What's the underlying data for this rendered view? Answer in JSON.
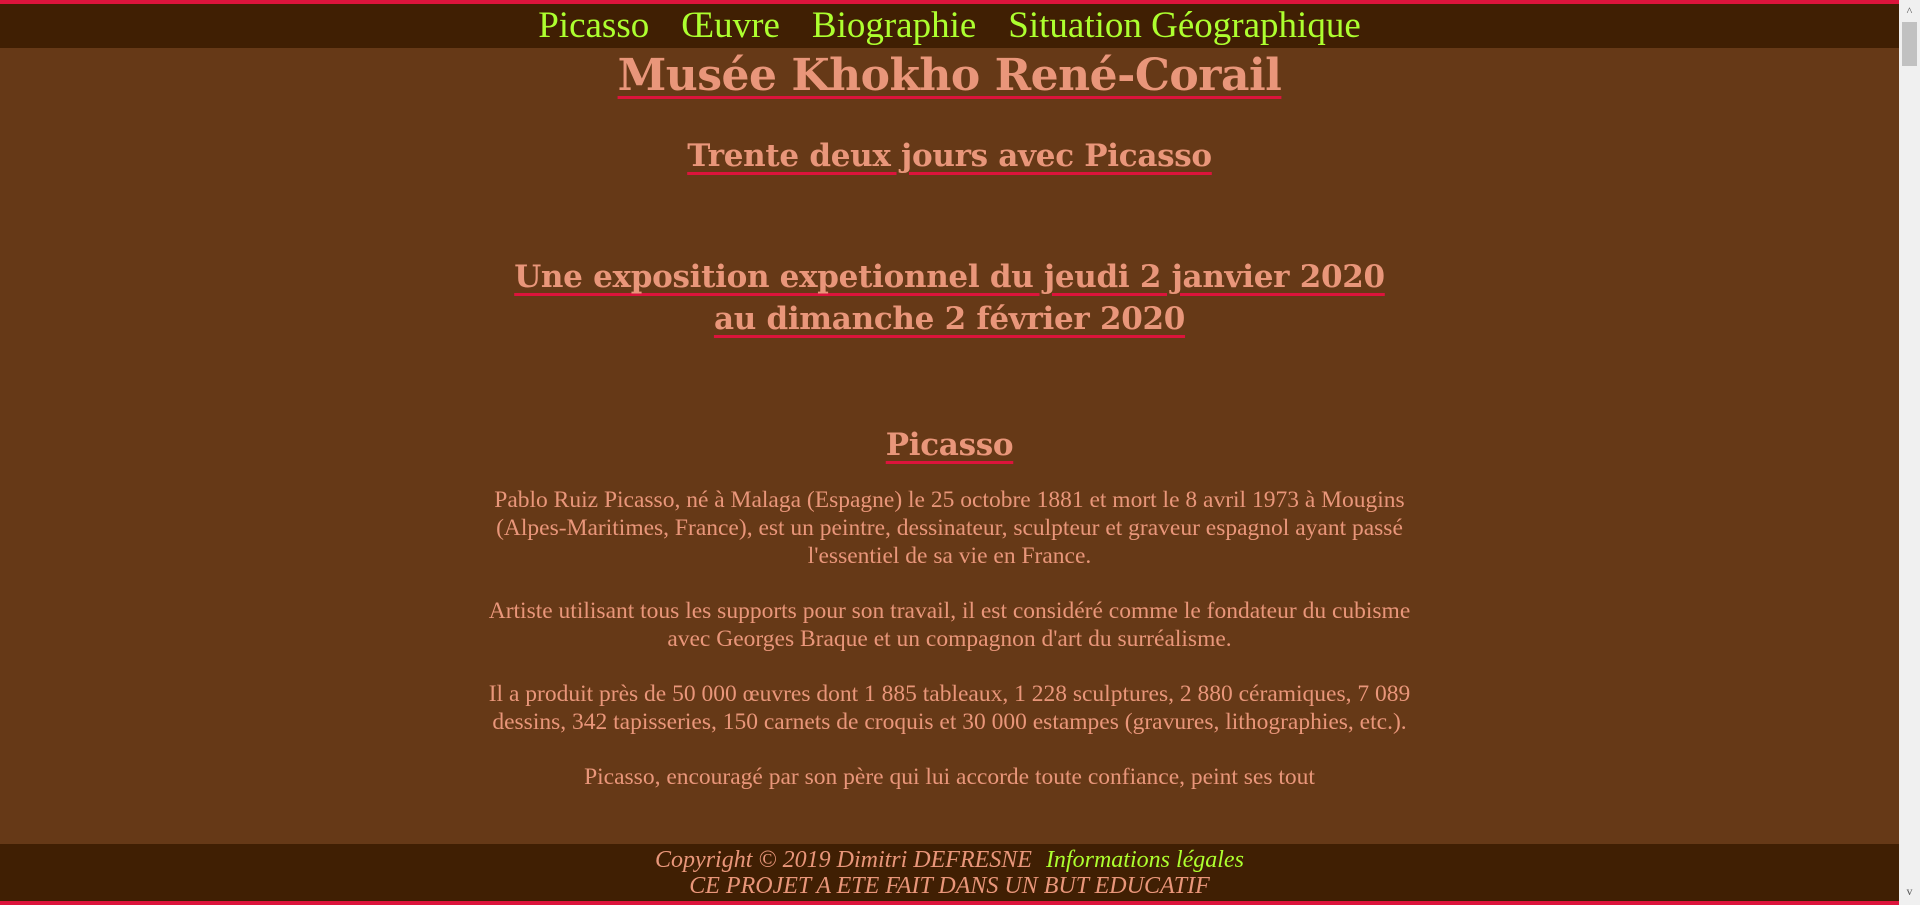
{
  "nav": {
    "items": [
      "Picasso",
      "Œuvre",
      "Biographie",
      "Situation Géographique"
    ]
  },
  "main": {
    "title": "Musée Khokho René-Corail",
    "subtitle": "Trente deux jours avec Picasso",
    "exposition": "Une exposition expetionnel du jeudi 2 janvier 2020 au dimanche 2 février 2020",
    "section_title": "Picasso",
    "paragraphs": [
      "Pablo Ruiz Picasso, né à Malaga (Espagne) le 25 octobre 1881 et mort le 8 avril 1973 à Mougins (Alpes-Maritimes, France), est un peintre, dessinateur, sculpteur et graveur espagnol ayant passé l'essentiel de sa vie en France.",
      "Artiste utilisant tous les supports pour son travail, il est considéré comme le fondateur du cubisme avec Georges Braque et un compagnon d'art du surréalisme.",
      "Il a produit près de 50 000 œuvres dont 1 885 tableaux, 1 228 sculptures, 2 880 céramiques, 7 089 dessins, 342 tapisseries, 150 carnets de croquis et 30 000 estampes (gravures, lithographies, etc.).",
      "Picasso, encouragé par son père qui lui accorde toute confiance, peint ses tout"
    ]
  },
  "footer": {
    "copyright": "Copyright © 2019 Dimitri DEFRESNE",
    "legal_link": "Informations légales",
    "note": "CE PROJET A ETE FAIT DANS UN BUT EDUCATIF"
  },
  "scrollbar": {
    "up": "^",
    "down": "v"
  }
}
